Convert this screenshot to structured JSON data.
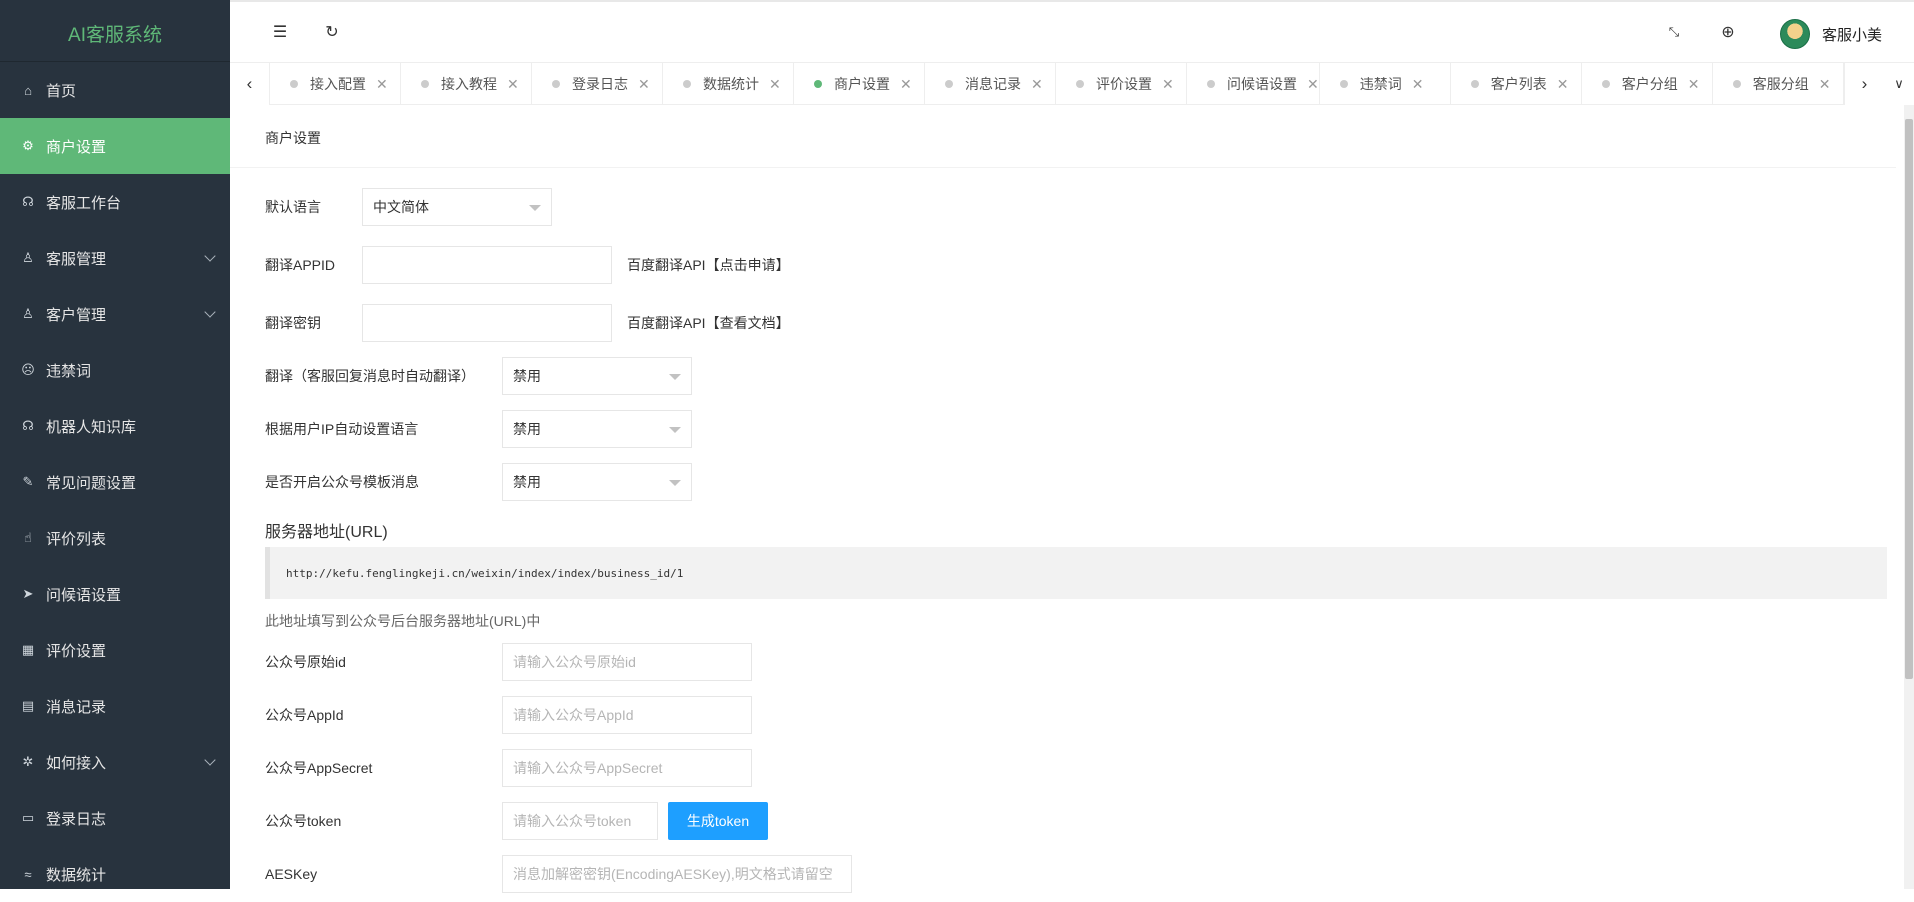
{
  "sidebar": {
    "title": "AI客服系统",
    "items": [
      {
        "label": "首页"
      },
      {
        "label": "商户设置"
      },
      {
        "label": "客服工作台"
      },
      {
        "label": "客服管理"
      },
      {
        "label": "客户管理"
      },
      {
        "label": "违禁词"
      },
      {
        "label": "机器人知识库"
      },
      {
        "label": "常见问题设置"
      },
      {
        "label": "评价列表"
      },
      {
        "label": "问候语设置"
      },
      {
        "label": "评价设置"
      },
      {
        "label": "消息记录"
      },
      {
        "label": "如何接入"
      },
      {
        "label": "登录日志"
      },
      {
        "label": "数据统计"
      }
    ]
  },
  "header": {
    "user_name": "客服小美"
  },
  "tabs": [
    {
      "label": "接入配置"
    },
    {
      "label": "接入教程"
    },
    {
      "label": "登录日志"
    },
    {
      "label": "数据统计"
    },
    {
      "label": "商户设置"
    },
    {
      "label": "消息记录"
    },
    {
      "label": "评价设置"
    },
    {
      "label": "问候语设置"
    },
    {
      "label": "违禁词"
    },
    {
      "label": "客户列表"
    },
    {
      "label": "客户分组"
    },
    {
      "label": "客服分组"
    }
  ],
  "form": {
    "card_title": "商户设置",
    "default_lang_label": "默认语言",
    "default_lang_value": "中文简体",
    "appid_label": "翻译APPID",
    "appid_aux": "百度翻译API【点击申请】",
    "secret_label": "翻译密钥",
    "secret_aux": "百度翻译API【查看文档】",
    "auto_translate_label": "翻译（客服回复消息时自动翻译）",
    "auto_translate_value": "禁用",
    "ip_lang_label": "根据用户IP自动设置语言",
    "ip_lang_value": "禁用",
    "mp_template_label": "是否开启公众号模板消息",
    "mp_template_value": "禁用",
    "server_url_heading": "服务器地址(URL)",
    "server_url": "http://kefu.fenglingkeji.cn/weixin/index/index/business_id/1",
    "server_url_hint": "此地址填写到公众号后台服务器地址(URL)中",
    "mp_id_label": "公众号原始id",
    "mp_id_placeholder": "请输入公众号原始id",
    "mp_appid_label": "公众号AppId",
    "mp_appid_placeholder": "请输入公众号AppId",
    "mp_secret_label": "公众号AppSecret",
    "mp_secret_placeholder": "请输入公众号AppSecret",
    "mp_token_label": "公众号token",
    "mp_token_placeholder": "请输入公众号token",
    "gen_token_label": "生成token",
    "aes_label": "AESKey",
    "aes_placeholder": "消息加解密密钥(EncodingAESKey),明文格式请留空"
  }
}
